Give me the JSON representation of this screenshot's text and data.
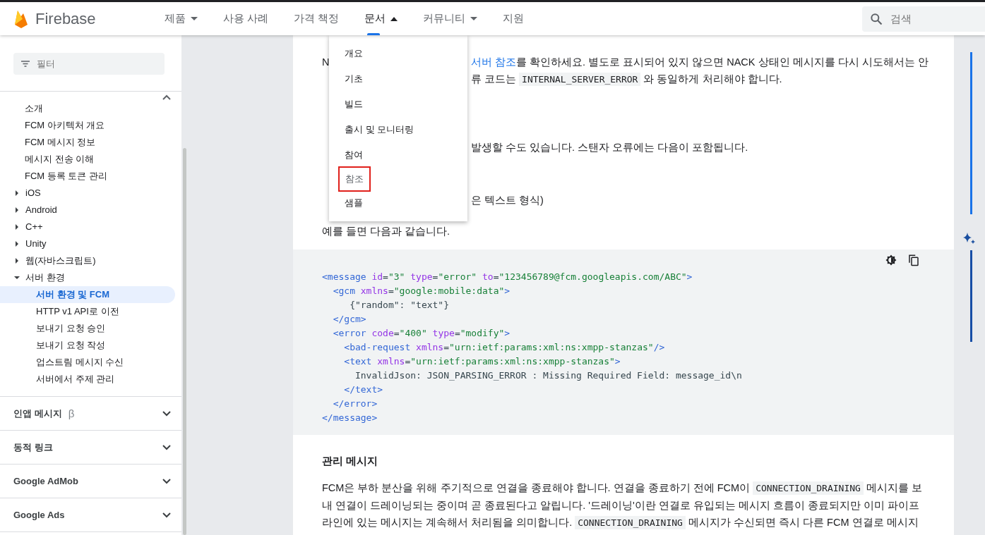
{
  "header": {
    "brand": "Firebase",
    "nav": [
      {
        "label": "제품",
        "kind": "menu",
        "expanded": false,
        "selected": false
      },
      {
        "label": "사용 사례",
        "kind": "link",
        "selected": false
      },
      {
        "label": "가격 책정",
        "kind": "link",
        "selected": false
      },
      {
        "label": "문서",
        "kind": "menu",
        "expanded": true,
        "selected": true
      },
      {
        "label": "커뮤니티",
        "kind": "menu",
        "expanded": false,
        "selected": false
      },
      {
        "label": "지원",
        "kind": "link",
        "selected": false
      }
    ],
    "search": {
      "placeholder": "검색"
    }
  },
  "sidebar": {
    "filter": {
      "placeholder": "필터"
    },
    "items": [
      {
        "label": "소개",
        "kind": "page",
        "selected": false
      },
      {
        "label": "FCM 아키텍처 개요",
        "kind": "page",
        "selected": false
      },
      {
        "label": "FCM 메시지 정보",
        "kind": "page",
        "selected": false
      },
      {
        "label": "메시지 전송 이해",
        "kind": "page",
        "selected": false
      },
      {
        "label": "FCM 등록 토큰 관리",
        "kind": "page",
        "selected": false
      },
      {
        "label": "iOS",
        "kind": "group",
        "expanded": false,
        "selected": false
      },
      {
        "label": "Android",
        "kind": "group",
        "expanded": false,
        "selected": false
      },
      {
        "label": "C++",
        "kind": "group",
        "expanded": false,
        "selected": false
      },
      {
        "label": "Unity",
        "kind": "group",
        "expanded": false,
        "selected": false
      },
      {
        "label": "웹(자바스크립트)",
        "kind": "group",
        "expanded": false,
        "selected": false
      },
      {
        "label": "서버 환경",
        "kind": "group",
        "expanded": true,
        "selected": false,
        "children": [
          {
            "label": "서버 환경 및 FCM",
            "selected": true
          },
          {
            "label": "HTTP v1 API로 이전",
            "selected": false
          },
          {
            "label": "보내기 요청 승인",
            "selected": false
          },
          {
            "label": "보내기 요청 작성",
            "selected": false
          },
          {
            "label": "업스트림 메시지 수신",
            "selected": false
          },
          {
            "label": "서버에서 주제 관리",
            "selected": false
          }
        ]
      }
    ],
    "sections": [
      {
        "label": "인앱 메시지",
        "badge": "β",
        "expanded": false
      },
      {
        "label": "동적 링크",
        "expanded": false
      },
      {
        "label": "Google AdMob",
        "expanded": false
      },
      {
        "label": "Google Ads",
        "expanded": false
      }
    ]
  },
  "menu": {
    "items": [
      {
        "label": "개요",
        "highlighted": false
      },
      {
        "label": "기초",
        "highlighted": false
      },
      {
        "label": "빌드",
        "highlighted": false
      },
      {
        "label": "출시 및 모니터링",
        "highlighted": false
      },
      {
        "label": "참여",
        "highlighted": false
      },
      {
        "label": "참조",
        "highlighted": true
      },
      {
        "label": "샘플",
        "highlighted": false
      }
    ]
  },
  "content": {
    "lines": [
      {
        "lead": "N",
        "segments": [
          {
            "kind": "link",
            "text": "서버 참조"
          },
          {
            "kind": "text",
            "text": "를 확인하세요. 별도로 표시되어 있지 않으면 NACK 상태인 메시지를 다시 시도해서는 안"
          }
        ]
      },
      {
        "segments": [
          {
            "kind": "text",
            "text": "류 코드는 "
          },
          {
            "kind": "code",
            "text": "INTERNAL_SERVER_ERROR"
          },
          {
            "kind": "text",
            "text": " 와 동일하게 처리해야 합니다."
          }
        ]
      },
      {
        "segments": [
          {
            "kind": "text",
            "text": "발생할 수도 있습니다. 스탠자 오류에는 다음이 포함됩니다."
          }
        ]
      },
      {
        "segments": [
          {
            "kind": "text",
            "text": "은 텍스트 형식)"
          }
        ]
      }
    ],
    "example": "예를 들면 다음과 같습니다.",
    "code": [
      [
        {
          "kind": "tag",
          "text": "<message "
        },
        {
          "kind": "attr",
          "text": "id"
        },
        {
          "kind": "plain",
          "text": "="
        },
        {
          "kind": "str",
          "text": "\"3\" "
        },
        {
          "kind": "attr",
          "text": "type"
        },
        {
          "kind": "plain",
          "text": "="
        },
        {
          "kind": "str",
          "text": "\"error\" "
        },
        {
          "kind": "attr",
          "text": "to"
        },
        {
          "kind": "plain",
          "text": "="
        },
        {
          "kind": "str",
          "text": "\"123456789@fcm.googleapis.com/ABC\""
        },
        {
          "kind": "tag",
          "text": ">"
        }
      ],
      [
        {
          "kind": "tag",
          "text": "  <gcm "
        },
        {
          "kind": "attr",
          "text": "xmlns"
        },
        {
          "kind": "plain",
          "text": "="
        },
        {
          "kind": "str",
          "text": "\"google:mobile:data\""
        },
        {
          "kind": "tag",
          "text": ">"
        }
      ],
      [
        {
          "kind": "plain",
          "text": "     {\"random\": \"text\"}"
        }
      ],
      [
        {
          "kind": "tag",
          "text": "  </gcm>"
        }
      ],
      [
        {
          "kind": "tag",
          "text": "  <error "
        },
        {
          "kind": "attr",
          "text": "code"
        },
        {
          "kind": "plain",
          "text": "="
        },
        {
          "kind": "str",
          "text": "\"400\" "
        },
        {
          "kind": "attr",
          "text": "type"
        },
        {
          "kind": "plain",
          "text": "="
        },
        {
          "kind": "str",
          "text": "\"modify\""
        },
        {
          "kind": "tag",
          "text": ">"
        }
      ],
      [
        {
          "kind": "tag",
          "text": "    <bad-request "
        },
        {
          "kind": "attr",
          "text": "xmlns"
        },
        {
          "kind": "plain",
          "text": "="
        },
        {
          "kind": "str",
          "text": "\"urn:ietf:params:xml:ns:xmpp-stanzas\""
        },
        {
          "kind": "tag",
          "text": "/>"
        }
      ],
      [
        {
          "kind": "tag",
          "text": "    <text "
        },
        {
          "kind": "attr",
          "text": "xmlns"
        },
        {
          "kind": "plain",
          "text": "="
        },
        {
          "kind": "str",
          "text": "\"urn:ietf:params:xml:ns:xmpp-stanzas\""
        },
        {
          "kind": "tag",
          "text": ">"
        }
      ],
      [
        {
          "kind": "plain",
          "text": "      InvalidJson: JSON_PARSING_ERROR : Missing Required Field: message_id\\n"
        }
      ],
      [
        {
          "kind": "tag",
          "text": "    </text>"
        }
      ],
      [
        {
          "kind": "tag",
          "text": "  </error>"
        }
      ],
      [
        {
          "kind": "tag",
          "text": "</message>"
        }
      ]
    ],
    "heading": "관리 메시지",
    "paragraph": [
      {
        "kind": "text",
        "text": "FCM은 부하 분산을 위해 주기적으로 연결을 종료해야 합니다. 연결을 종료하기 전에 FCM이 "
      },
      {
        "kind": "code",
        "text": "CONNECTION_DRAINING"
      },
      {
        "kind": "text",
        "text": " 메시지를 보내 연결이 드레이닝되는 중이며 곧 종료된다고 알립니다. '드레이닝'이란 연결로 유입되는 메시지 흐름이 종료되지만 이미 파이프라인에 있는 메시지는 계속해서 처리됨을 의미합니다. "
      },
      {
        "kind": "code",
        "text": "CONNECTION_DRAINING"
      },
      {
        "kind": "text",
        "text": " 메시지가 수신되면 즉시 다른 FCM 연결로 메시지"
      }
    ]
  }
}
